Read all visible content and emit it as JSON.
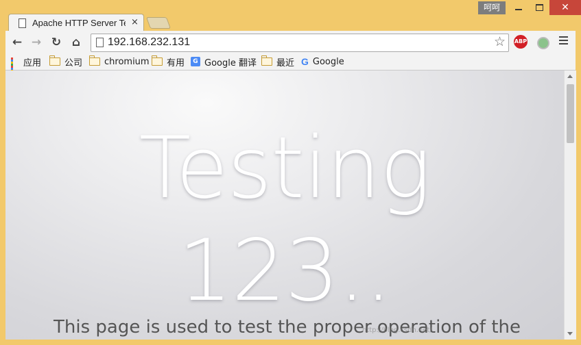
{
  "window": {
    "user_badge": "呵呵",
    "close_glyph": "✕"
  },
  "tabs": [
    {
      "title": "Apache HTTP Server Test Page",
      "close_glyph": "×"
    }
  ],
  "toolbar": {
    "back_glyph": "←",
    "forward_glyph": "→",
    "reload_glyph": "↻",
    "home_glyph": "⌂",
    "url": "192.168.232.131",
    "star_glyph": "☆",
    "abp_label": "ABP"
  },
  "bookmarks": {
    "items": [
      {
        "label": "应用",
        "icon": "apps-grid-icon"
      },
      {
        "label": "公司",
        "icon": "folder-icon"
      },
      {
        "label": "chromium",
        "icon": "folder-icon"
      },
      {
        "label": "有用",
        "icon": "folder-icon"
      },
      {
        "label": "Google 翻译",
        "icon": "google-translate-icon"
      },
      {
        "label": "最近",
        "icon": "folder-icon"
      },
      {
        "label": "Google",
        "icon": "google-g-icon"
      }
    ],
    "translate_glyph": "G",
    "google_glyph": "G"
  },
  "page": {
    "hero_line1": "Testing",
    "hero_line2": "123..",
    "intro_text": "This page is used to test the proper operation of the"
  },
  "watermark": "http://blog.csdn.net/...",
  "colors": {
    "frame": "#f2c96b",
    "close_button": "#c7463a",
    "abp_red": "#d21f26"
  }
}
